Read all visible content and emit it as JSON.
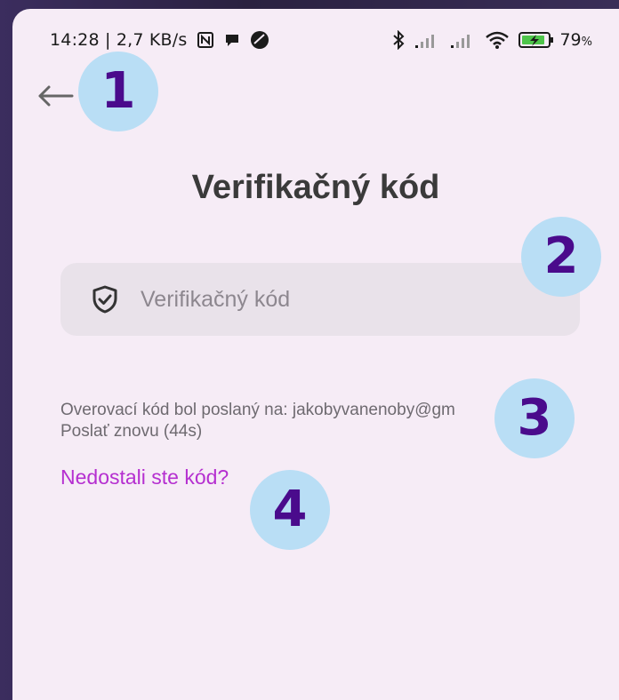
{
  "status_bar": {
    "time_speed": "14:28 | 2,7 KB/s",
    "battery_percent": "79",
    "battery_unit": "%"
  },
  "page": {
    "title": "Verifikačný kód",
    "code_input": {
      "placeholder": "Verifikačný kód",
      "value": ""
    },
    "info_line": "Overovací kód bol poslaný na: jakobyvanenoby@gm",
    "resend_label": "Poslať znovu (44s)",
    "help_link": "Nedostali ste kód?"
  },
  "annotations": [
    "1",
    "2",
    "3",
    "4"
  ],
  "colors": {
    "background": "#f6ecf6",
    "input_bg": "#e9e2ea",
    "link": "#b52fd0",
    "badge_bg": "#b9def5",
    "badge_text": "#4a0b8c"
  },
  "icons": {
    "back": "arrow-left-icon",
    "input": "shield-check-icon"
  }
}
